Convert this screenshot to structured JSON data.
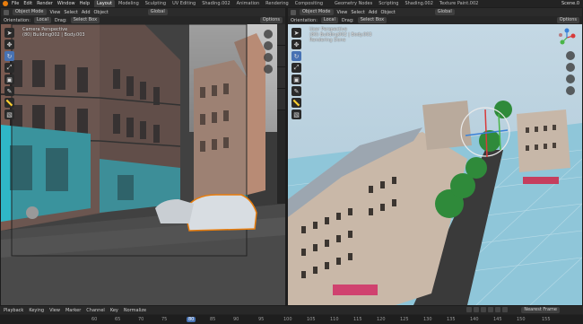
{
  "topbar": {
    "menus": [
      "File",
      "Edit",
      "Render",
      "Window",
      "Help"
    ],
    "left_workspaces": [
      {
        "label": "Layout",
        "active": true
      },
      {
        "label": "Modeling",
        "active": false
      },
      {
        "label": "Sculpting",
        "active": false
      },
      {
        "label": "UV Editing",
        "active": false
      },
      {
        "label": "Shading.002",
        "active": false
      },
      {
        "label": "Animation",
        "active": false
      },
      {
        "label": "Rendering",
        "active": false
      },
      {
        "label": "Compositing",
        "active": false
      }
    ],
    "right_workspaces": [
      "Geometry Nodes",
      "Scripting",
      "Shading.002",
      "Texture Paint.002"
    ],
    "scene_name": "Scene.0"
  },
  "left_viewport": {
    "mode": "Object Mode",
    "menus": [
      "View",
      "Select",
      "Add",
      "Object"
    ],
    "transform_space": "Global",
    "orientation_label": "Orientation:",
    "orientation_value": "Local",
    "drag_label": "Drag:",
    "drag_value": "Select Box",
    "options_label": "Options",
    "view_name": "Camera Perspective",
    "object_path": "(80) Building002 | Body.003"
  },
  "right_viewport": {
    "mode": "Object Mode",
    "menus": [
      "View",
      "Select",
      "Add",
      "Object"
    ],
    "transform_space": "Global",
    "orientation_label": "Orientation:",
    "orientation_value": "Local",
    "drag_label": "Drag:",
    "drag_value": "Select Box",
    "options_label": "Options",
    "view_name": "User Perspective",
    "object_path": "(80) Building002 | Body.003",
    "status": "Rendering Done"
  },
  "tools": [
    "cursor-icon",
    "move-icon",
    "rotate-icon",
    "scale-icon",
    "transform-icon",
    "annotate-icon",
    "measure-icon",
    "add-cube-icon"
  ],
  "timeline": {
    "menus": [
      "Playback",
      "Keying",
      "View",
      "Marker",
      "Channel",
      "Key"
    ],
    "normalize_label": "Normalize",
    "frame_mode": "Nearest Frame",
    "ticks": [
      "60",
      "65",
      "70",
      "75",
      "80",
      "85",
      "90",
      "95",
      "100",
      "105",
      "110",
      "115",
      "120",
      "125",
      "130",
      "135",
      "140",
      "145",
      "150",
      "155"
    ],
    "current_frame": "80"
  },
  "colors": {
    "accent": "#4772b3",
    "blender_orange": "#e87d0d"
  }
}
